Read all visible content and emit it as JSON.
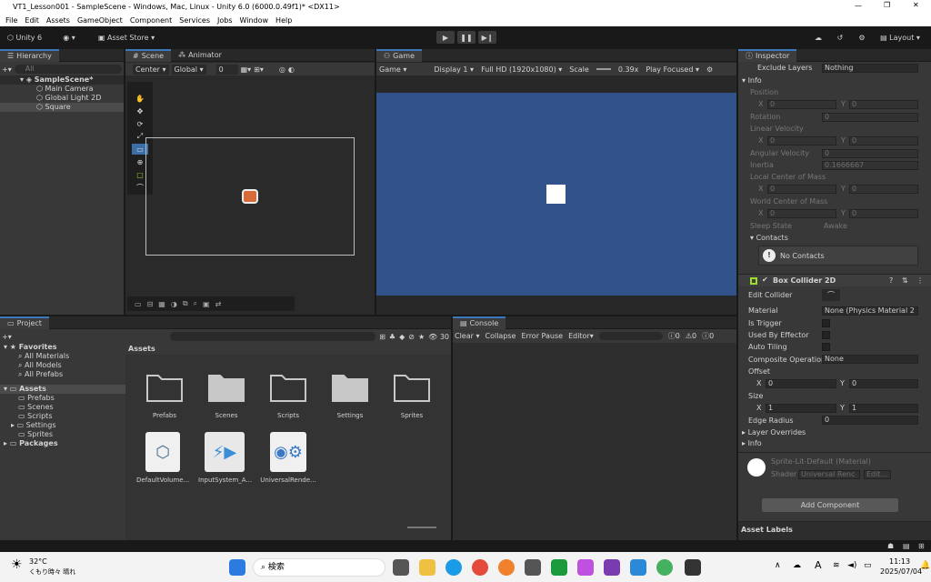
{
  "window": {
    "title": "VT1_Lesson001 - SampleScene - Windows, Mac, Linux - Unity 6.0 (6000.0.49f1)* <DX11>"
  },
  "menu": [
    "File",
    "Edit",
    "Assets",
    "GameObject",
    "Component",
    "Services",
    "Jobs",
    "Window",
    "Help"
  ],
  "toolbar": {
    "account": "Unity 6",
    "asset_store": "Asset Store",
    "layout": "Layout"
  },
  "hierarchy": {
    "tab": "Hierarchy",
    "search": "All",
    "scene": "SampleScene*",
    "items": [
      "Main Camera",
      "Global Light 2D",
      "Square"
    ]
  },
  "scene": {
    "tab": "Scene",
    "tab2": "Animator",
    "pivot": "Center",
    "space": "Global",
    "snap": "0"
  },
  "game": {
    "tab": "Game",
    "mode": "Game",
    "display": "Display 1",
    "resolution": "Full HD (1920x1080)",
    "scale_label": "Scale",
    "scale": "0.39x",
    "play": "Play Focused"
  },
  "inspector": {
    "tab": "Inspector",
    "exclude_layers_label": "Exclude Layers",
    "exclude_layers": "Nothing",
    "info": "Info",
    "position": "Position",
    "pos_x": "0",
    "pos_y": "0",
    "rotation": "Rotation",
    "rotation_val": "0",
    "linear_velocity": "Linear Velocity",
    "lv_x": "0",
    "lv_y": "0",
    "angular_velocity": "Angular Velocity",
    "av": "0",
    "inertia": "Inertia",
    "inertia_val": "0.1666667",
    "local_com": "Local Center of Mass",
    "lc_x": "0",
    "lc_y": "0",
    "world_com": "World Center of Mass",
    "wc_x": "0",
    "wc_y": "0",
    "sleep_state": "Sleep State",
    "sleep_val": "Awake",
    "contacts": "Contacts",
    "no_contacts": "No Contacts",
    "box_collider": "Box Collider 2D",
    "edit_collider": "Edit Collider",
    "material": "Material",
    "material_val": "None (Physics Material 2",
    "is_trigger": "Is Trigger",
    "used_by_effector": "Used By Effector",
    "auto_tiling": "Auto Tiling",
    "composite": "Composite Operation",
    "composite_val": "None",
    "offset": "Offset",
    "off_x": "0",
    "off_y": "0",
    "size": "Size",
    "size_x": "1",
    "size_y": "1",
    "edge_radius": "Edge Radius",
    "edge_val": "0",
    "layer_overrides": "Layer Overrides",
    "info2": "Info",
    "mat_name": "Sprite-Lit-Default (Material)",
    "shader": "Shader",
    "shader_val": "Universal Renc",
    "edit": "Edit...",
    "add_component": "Add Component",
    "asset_labels": "Asset Labels"
  },
  "project": {
    "tab": "Project",
    "count": "30",
    "favorites": "Favorites",
    "fav_items": [
      "All Materials",
      "All Models",
      "All Prefabs"
    ],
    "assets": "Assets",
    "asset_folders": [
      "Prefabs",
      "Scenes",
      "Scripts",
      "Settings",
      "Sprites"
    ],
    "packages": "Packages",
    "breadcrumb": "Assets",
    "grid_folders": [
      "Prefabs",
      "Scenes",
      "Scripts",
      "Settings",
      "Sprites"
    ],
    "grid_files": [
      "DefaultVolume...",
      "InputSystem_A...",
      "UniversalRende..."
    ]
  },
  "console": {
    "tab": "Console",
    "clear": "Clear",
    "collapse": "Collapse",
    "error_pause": "Error Pause",
    "editor": "Editor",
    "c1": "0",
    "c2": "0",
    "c3": "0"
  },
  "taskbar": {
    "temp": "32°C",
    "weather": "くもり時々 晴れ",
    "search": "検索",
    "time": "11:13",
    "date": "2025/07/04",
    "ime": "A"
  }
}
